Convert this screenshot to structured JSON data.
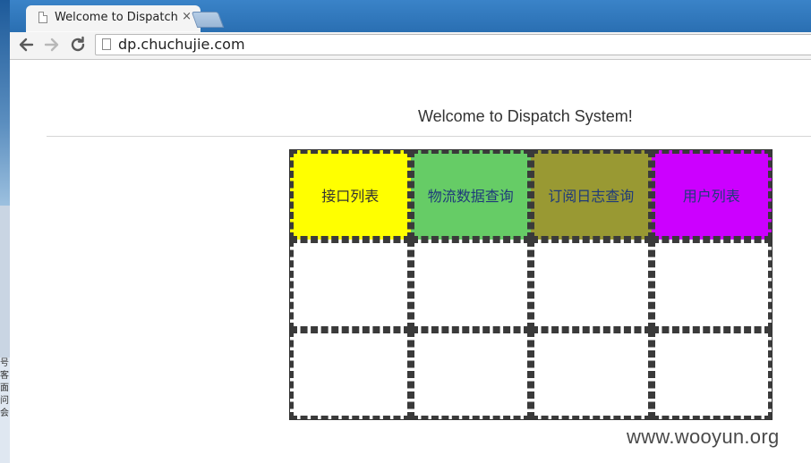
{
  "browser": {
    "tab_title": "Welcome to Dispatch",
    "tab_close": "×",
    "back_glyph": "🡐",
    "forward_glyph": "🡒",
    "reload_glyph": "⟳",
    "url": "dp.chuchujie.com"
  },
  "desktop": {
    "edge_glyphs": "号\n客\n面\n问\n会"
  },
  "page": {
    "title": "Welcome to Dispatch System!"
  },
  "menu": {
    "items": [
      {
        "label": "接口列表",
        "bg": "#ffff00",
        "color": "#333333"
      },
      {
        "label": "物流数据查询",
        "bg": "#66cc66",
        "color": "#1f3a7a"
      },
      {
        "label": "订阅日志查询",
        "bg": "#999933",
        "color": "#1f3a7a"
      },
      {
        "label": "用户列表",
        "bg": "#cc00ff",
        "color": "#1f3a7a"
      }
    ],
    "empty_cell_bg": "#ffffff"
  },
  "watermark": {
    "text": "www.wooyun.org"
  },
  "icons": {
    "tab_icon": "document-icon",
    "omnibox_icon": "page-icon"
  }
}
